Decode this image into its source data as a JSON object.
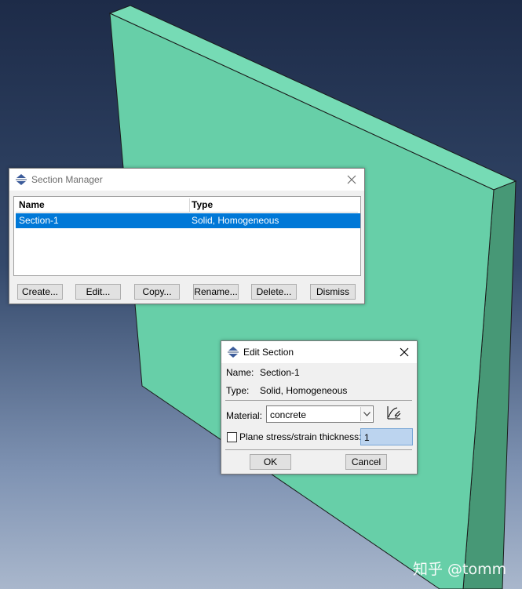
{
  "watermark": "知乎 @tomm",
  "viewport": {
    "plate_face_color": "#67cfa8",
    "plate_side_color": "#479876",
    "plate_top_color": "#76dbb5"
  },
  "section_manager": {
    "title": "Section Manager",
    "columns": [
      "Name",
      "Type"
    ],
    "rows": [
      {
        "name": "Section-1",
        "type": "Solid, Homogeneous",
        "selected": true
      }
    ],
    "buttons": {
      "create": "Create...",
      "edit": "Edit...",
      "copy": "Copy...",
      "rename": "Rename...",
      "delete": "Delete...",
      "dismiss": "Dismiss"
    },
    "selection_color": "#0078d7"
  },
  "edit_section": {
    "title": "Edit Section",
    "name_label": "Name:",
    "name_value": "Section-1",
    "type_label": "Type:",
    "type_value": "Solid, Homogeneous",
    "material_label": "Material:",
    "material_value": "concrete",
    "thickness_label": "Plane stress/strain thickness:",
    "thickness_value": "1",
    "thickness_checked": false,
    "ok_label": "OK",
    "cancel_label": "Cancel"
  }
}
